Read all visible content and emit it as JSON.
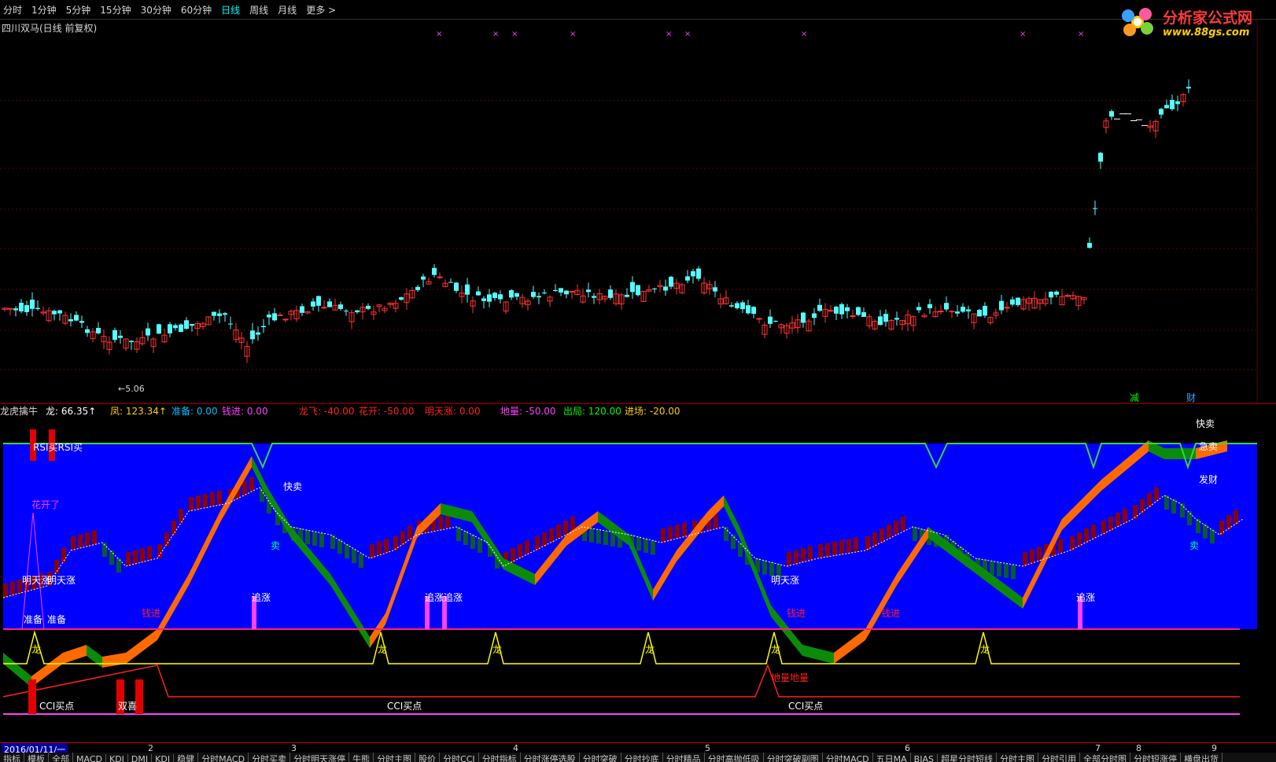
{
  "toolbar": {
    "periods": [
      "分时",
      "1分钟",
      "5分钟",
      "15分钟",
      "30分钟",
      "60分钟",
      "日线",
      "周线",
      "月线",
      "更多 >"
    ],
    "active_period": "日线"
  },
  "stock": {
    "title": "四川双马(日线 前复权)",
    "low_marker": "←5.06"
  },
  "logo": {
    "brand": "分析家公式网",
    "url": "www.88gs.com"
  },
  "main_markers": {
    "jian": "减",
    "cai": "财"
  },
  "indicator": {
    "name": "龙虎擒牛",
    "fields": [
      {
        "label": "龙:",
        "value": "66.35↑",
        "color": "#ffffff"
      },
      {
        "label": "凤:",
        "value": "123.34↑",
        "color": "#ffd000"
      },
      {
        "label": "准备:",
        "value": "0.00",
        "color": "#00c0ff"
      },
      {
        "label": "钱进:",
        "value": "0.00",
        "color": "#ff40ff"
      },
      {
        "label": "龙飞:",
        "value": "-40.00",
        "color": "#ff2020"
      },
      {
        "label": "花开:",
        "value": "-50.00",
        "color": "#ff2020"
      },
      {
        "label": "明天涨:",
        "value": "0.00",
        "color": "#ff2020"
      },
      {
        "label": "地量:",
        "value": "-50.00",
        "color": "#ff40ff"
      },
      {
        "label": "出局:",
        "value": "120.00",
        "color": "#00ff00"
      },
      {
        "label": "进场:",
        "value": "-20.00",
        "color": "#ffd000"
      }
    ]
  },
  "signals": {
    "rsi_buy": "RSI买RSI买",
    "quick_sell": "快卖",
    "flower": "花开了",
    "sell": "卖",
    "tomorrow_up": "明天涨",
    "tomorrow_up2": "明天涨",
    "chase": "追涨",
    "chase2": "追涨追涨",
    "ready": "准备",
    "qian_jin": "钱进",
    "long": "龙",
    "cci_buy": "CCI买点",
    "cci_buy2": "CCI买点",
    "cci_buy3": "CCI买点",
    "xi": "双喜",
    "diliang": "地量地量",
    "facai": "发财",
    "urgent_sell": "急卖"
  },
  "date_axis": {
    "current": "2016/01/11/一",
    "months": [
      "2",
      "3",
      "4",
      "5",
      "6",
      "7",
      "8",
      "9"
    ]
  },
  "bottom_tabs": [
    "指标",
    "模板",
    "全部",
    "MACD",
    "KDJ",
    "DMI",
    "KDJ",
    "稳健",
    "分时MACD",
    "分时买卖",
    "分时明天涨停",
    "牛熊",
    "分时主图",
    "股价",
    "分时CCI",
    "分时指标",
    "分时涨停选股",
    "分时突破",
    "分时抄底",
    "分时精品",
    "分时高抛低吸",
    "分时突破副图",
    "分时MACD",
    "五日MA",
    "BIAS",
    "超星分时短线",
    "分时主图",
    "分时引用",
    "全部分时图",
    "分时短涨停",
    "横盘出货"
  ],
  "colors": {
    "up": "#ff3232",
    "down": "#54ffff",
    "sub_bg": "#0000ff",
    "orange": "#ff6a00",
    "green": "#0a8c0a"
  }
}
